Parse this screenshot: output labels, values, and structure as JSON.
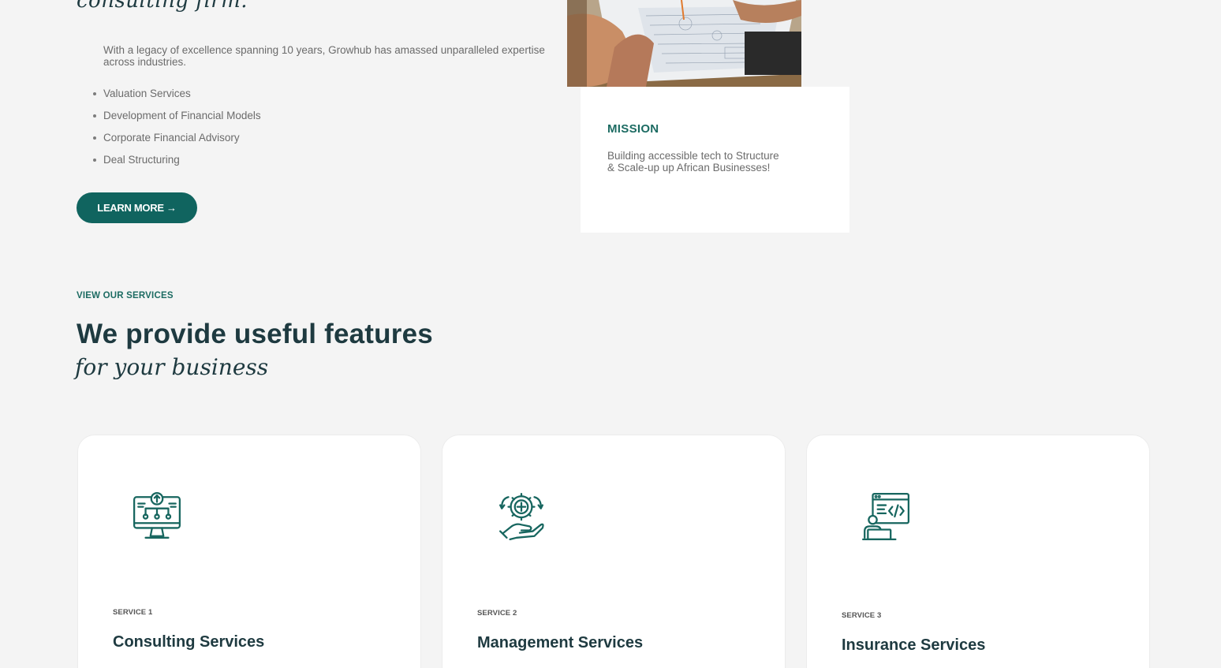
{
  "hero": {
    "script_heading": "consulting firm.",
    "intro": "With a legacy of excellence spanning 10 years, Growhub has amassed unparalleled expertise across industries.",
    "features": [
      "Valuation Services",
      "Development of Financial Models",
      "Corporate Financial Advisory",
      "Deal Structuring"
    ],
    "cta_label": "LEARN MORE →"
  },
  "mission": {
    "title": "MISSION",
    "text": "Building accessible tech to Structure & Scale-up up African Businesses!"
  },
  "services_section": {
    "eyebrow": "VIEW OUR SERVICES",
    "title": "We provide useful features",
    "script": "for your business",
    "cards": [
      {
        "label": "SERVICE 1",
        "title": "Consulting Services",
        "icon": "monitor-network-icon"
      },
      {
        "label": "SERVICE 2",
        "title": "Management Services",
        "icon": "gear-hand-icon"
      },
      {
        "label": "SERVICE 3",
        "title": "Insurance Services",
        "icon": "developer-code-icon"
      }
    ]
  },
  "colors": {
    "accent": "#10645f",
    "heading": "#1e3a40",
    "background": "#f4f4f4"
  }
}
